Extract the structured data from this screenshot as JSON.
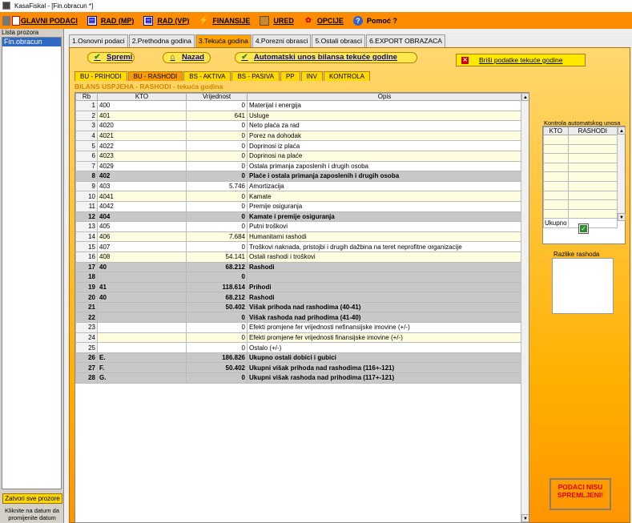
{
  "window": {
    "title": "KasaFiskal  - [Fin.obracun *]"
  },
  "menu": [
    {
      "label": "GLAVNI PODACI",
      "icon": "calculator-icon"
    },
    {
      "label": "RAD (MP)",
      "icon": "document-icon"
    },
    {
      "label": "RAD (VP)",
      "icon": "document-icon"
    },
    {
      "label": "FINANSIJE",
      "icon": "coins-icon"
    },
    {
      "label": "URED",
      "icon": "folder-icon"
    },
    {
      "label": "OPCIJE",
      "icon": "settings-icon"
    },
    {
      "label": "Pomoć ?",
      "icon": "help-icon"
    }
  ],
  "sidebar": {
    "header": "Lista prozora",
    "selected": "Fin.obracun",
    "close_all": "Zatvori sve prozore",
    "hint": "Kliknite na datum da promijenite datum"
  },
  "tabs": [
    {
      "label": "1.Osnovni podaci",
      "active": false
    },
    {
      "label": "2.Prethodna godina",
      "active": false
    },
    {
      "label": "3.Tekuća godina",
      "active": true
    },
    {
      "label": "4.Porezni obrasci",
      "active": false
    },
    {
      "label": "5.Ostali obrasci",
      "active": false
    },
    {
      "label": "6.EXPORT OBRAZACA",
      "active": false
    }
  ],
  "actions": {
    "save": "Spremi",
    "back": "Nazad",
    "auto": "Automatski unos bilansa tekuće godine",
    "delete": "Briši podatke tekuće godine"
  },
  "subtabs": [
    {
      "label": "BU - PRIHODI",
      "active": false
    },
    {
      "label": "BU - RASHODI",
      "active": true
    },
    {
      "label": "BS - AKTIVA",
      "active": false
    },
    {
      "label": "BS - PASIVA",
      "active": false
    },
    {
      "label": "PP",
      "active": false
    },
    {
      "label": "INV",
      "active": false
    },
    {
      "label": "KONTROLA",
      "active": false
    }
  ],
  "report_title": "BILANS USPJEHA - RASHODI - tekuća godina",
  "table": {
    "columns": [
      "Rb",
      "KTO",
      "Vrijednost",
      "Opis"
    ],
    "rows": [
      {
        "rb": "1",
        "kto": "400",
        "vr": "0",
        "opis": "Materijal i energija",
        "bold": false
      },
      {
        "rb": "2",
        "kto": "401",
        "vr": "641",
        "opis": "Usluge",
        "bold": false
      },
      {
        "rb": "3",
        "kto": "4020",
        "vr": "0",
        "opis": " Neto plaća za rad",
        "bold": false
      },
      {
        "rb": "4",
        "kto": "4021",
        "vr": "0",
        "opis": "Porez na dohodak",
        "bold": false
      },
      {
        "rb": "5",
        "kto": "4022",
        "vr": "0",
        "opis": " Doprinosi iz plaća",
        "bold": false
      },
      {
        "rb": "6",
        "kto": "4023",
        "vr": "0",
        "opis": " Doprinosi na plaće",
        "bold": false
      },
      {
        "rb": "7",
        "kto": "4029",
        "vr": "0",
        "opis": " Ostala primanja zaposlenih i drugih osoba",
        "bold": false
      },
      {
        "rb": "8",
        "kto": "402",
        "vr": "0",
        "opis": "Plaće i ostala primanja zaposlenih i drugih osoba",
        "bold": true
      },
      {
        "rb": "9",
        "kto": "403",
        "vr": "5.746",
        "opis": "Amortizacija",
        "bold": false
      },
      {
        "rb": "10",
        "kto": "4041",
        "vr": "0",
        "opis": "Kamate",
        "bold": false
      },
      {
        "rb": "11",
        "kto": "4042",
        "vr": "0",
        "opis": "Premije osiguranja",
        "bold": false
      },
      {
        "rb": "12",
        "kto": "404",
        "vr": "0",
        "opis": "Kamate i premije osiguranja",
        "bold": true
      },
      {
        "rb": "13",
        "kto": "405",
        "vr": "0",
        "opis": "Putni troškovi",
        "bold": false
      },
      {
        "rb": "14",
        "kto": "406",
        "vr": "7.684",
        "opis": "Humanitarni rashodi",
        "bold": false
      },
      {
        "rb": "15",
        "kto": "407",
        "vr": "0",
        "opis": "Troškovi naknada, pristojbi i drugih dažbina na teret neprofitne organizacije",
        "bold": false
      },
      {
        "rb": "16",
        "kto": "408",
        "vr": "54.141",
        "opis": "Ostali rashodi i troškovi",
        "bold": false
      },
      {
        "rb": "17",
        "kto": "40",
        "vr": "68.212",
        "opis": "Rashodi",
        "bold": true
      },
      {
        "rb": "18",
        "kto": "",
        "vr": "0",
        "opis": "",
        "bold": true
      },
      {
        "rb": "19",
        "kto": "41",
        "vr": "118.614",
        "opis": "Prihodi",
        "bold": true
      },
      {
        "rb": "20",
        "kto": "40",
        "vr": "68.212",
        "opis": "Rashodi",
        "bold": true
      },
      {
        "rb": "21",
        "kto": "",
        "vr": "50.402",
        "opis": "Višak prihoda nad rashodima (40-41)",
        "bold": true
      },
      {
        "rb": "22",
        "kto": "",
        "vr": "0",
        "opis": "Višak rashoda nad prihodima (41-40)",
        "bold": true
      },
      {
        "rb": "23",
        "kto": "",
        "vr": "0",
        "opis": "Efekti promjene fer vrijednosti nefinansijske imovine (+/-)",
        "bold": false
      },
      {
        "rb": "24",
        "kto": "",
        "vr": "0",
        "opis": "Efekti promjene fer vrijednosti finansijske imovine (+/-)",
        "bold": false
      },
      {
        "rb": "25",
        "kto": "",
        "vr": "0",
        "opis": "Ostalo (+/-)",
        "bold": false
      },
      {
        "rb": "26",
        "kto": "E.",
        "vr": "186.826",
        "opis": "Ukupno ostali dobici i gubici",
        "bold": true
      },
      {
        "rb": "27",
        "kto": "F.",
        "vr": "50.402",
        "opis": "Ukupni višak prihoda nad rashodima (116+-121)",
        "bold": true
      },
      {
        "rb": "28",
        "kto": "G.",
        "vr": "0",
        "opis": "Ukupni višak rashoda nad prihodima (117+-121)",
        "bold": true
      }
    ]
  },
  "control": {
    "title": "Kontrola automatskog unosa",
    "columns": [
      "KTO",
      "RASHODI"
    ],
    "total_label": "Ukupno"
  },
  "differences_label": "Razlike rashoda",
  "status": "PODACI NISU SPREMLJENI!",
  "colors": {
    "menu_bg": "#ff8c00",
    "panel_gradient_top": "#ffd870",
    "panel_gradient_bottom": "#ff9500",
    "warning": "#e00000"
  }
}
